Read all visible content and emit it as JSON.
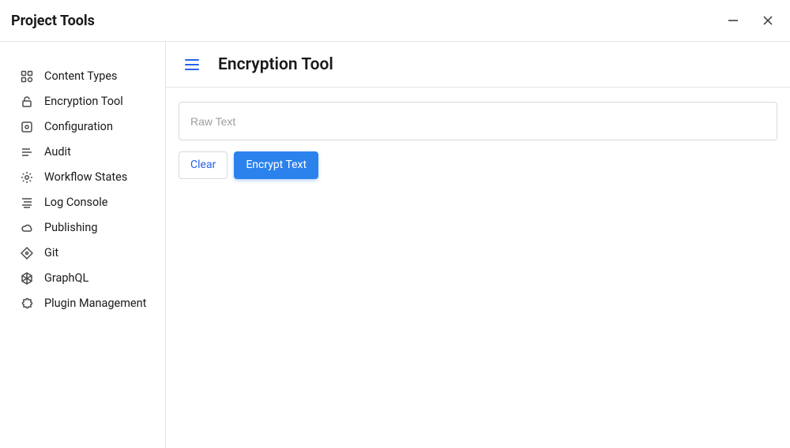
{
  "titlebar": {
    "title": "Project Tools"
  },
  "sidebar": {
    "items": [
      {
        "label": "Content Types",
        "icon": "grid"
      },
      {
        "label": "Encryption Tool",
        "icon": "lock"
      },
      {
        "label": "Configuration",
        "icon": "crosshair"
      },
      {
        "label": "Audit",
        "icon": "list"
      },
      {
        "label": "Workflow States",
        "icon": "gear"
      },
      {
        "label": "Log Console",
        "icon": "lines"
      },
      {
        "label": "Publishing",
        "icon": "cloud"
      },
      {
        "label": "Git",
        "icon": "diamond"
      },
      {
        "label": "GraphQL",
        "icon": "hex"
      },
      {
        "label": "Plugin Management",
        "icon": "puzzle"
      }
    ]
  },
  "main": {
    "title": "Encryption Tool",
    "input": {
      "placeholder": "Raw Text",
      "value": ""
    },
    "buttons": {
      "clear": "Clear",
      "encrypt": "Encrypt Text"
    }
  }
}
